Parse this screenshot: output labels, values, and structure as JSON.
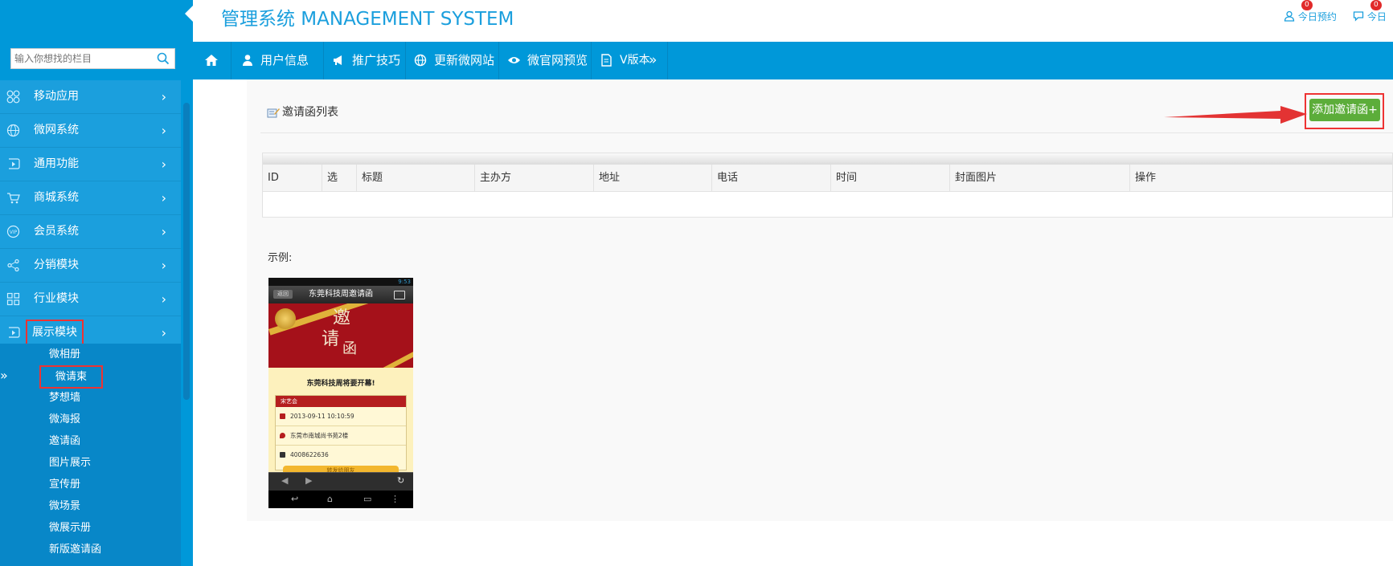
{
  "header": {
    "brand": "管理系统 MANAGEMENT SYSTEM",
    "links": [
      {
        "label": "今日预约",
        "badge": "0"
      },
      {
        "label": "今日",
        "badge": "0"
      }
    ]
  },
  "sidebar": {
    "search_placeholder": "输入你想找的栏目",
    "items": [
      {
        "label": "移动应用",
        "icon": "apps-icon"
      },
      {
        "label": "微网系统",
        "icon": "globe-icon"
      },
      {
        "label": "通用功能",
        "icon": "play-icon"
      },
      {
        "label": "商城系统",
        "icon": "cart-icon"
      },
      {
        "label": "会员系统",
        "icon": "vip-icon"
      },
      {
        "label": "分销模块",
        "icon": "share-icon"
      },
      {
        "label": "行业模块",
        "icon": "grid-icon"
      },
      {
        "label": "展示模块",
        "icon": "play-icon"
      }
    ],
    "subitems": [
      "微相册",
      "微请柬",
      "梦想墙",
      "微海报",
      "邀请函",
      "图片展示",
      "宣传册",
      "微场景",
      "微展示册",
      "新版邀请函"
    ],
    "collapse": "»"
  },
  "nav": {
    "home_icon": "home-icon",
    "items": [
      {
        "label": "用户信息",
        "icon": "user-icon"
      },
      {
        "label": "推广技巧",
        "icon": "megaphone-icon"
      },
      {
        "label": "更新微网站",
        "icon": "globe-icon"
      },
      {
        "label": "微官网预览",
        "icon": "eye-icon"
      },
      {
        "label": "V版本",
        "icon": "doc-icon"
      }
    ],
    "more": "»"
  },
  "content": {
    "list_title": "邀请函列表",
    "add_button": "添加邀请函+",
    "columns": [
      "ID",
      "选",
      "标题",
      "主办方",
      "地址",
      "电话",
      "时间",
      "封面图片",
      "操作"
    ],
    "example_label": "示例:"
  },
  "phone": {
    "status_time": "9:53",
    "title": "东莞科技周邀请函",
    "back": "返回",
    "calligraphy": [
      "邀",
      "请",
      "函"
    ],
    "headline": "东莞科技周将要开幕!",
    "card_caption": "宋艺会",
    "rows": [
      "2013-09-11 10:10:59",
      "东莞市南城尚书苑2楼",
      "4008622636"
    ],
    "button": "转发给朋友"
  },
  "colors": {
    "primary": "#0098d9",
    "accent_green": "#5cad3a",
    "annotation_red": "#e33333"
  }
}
